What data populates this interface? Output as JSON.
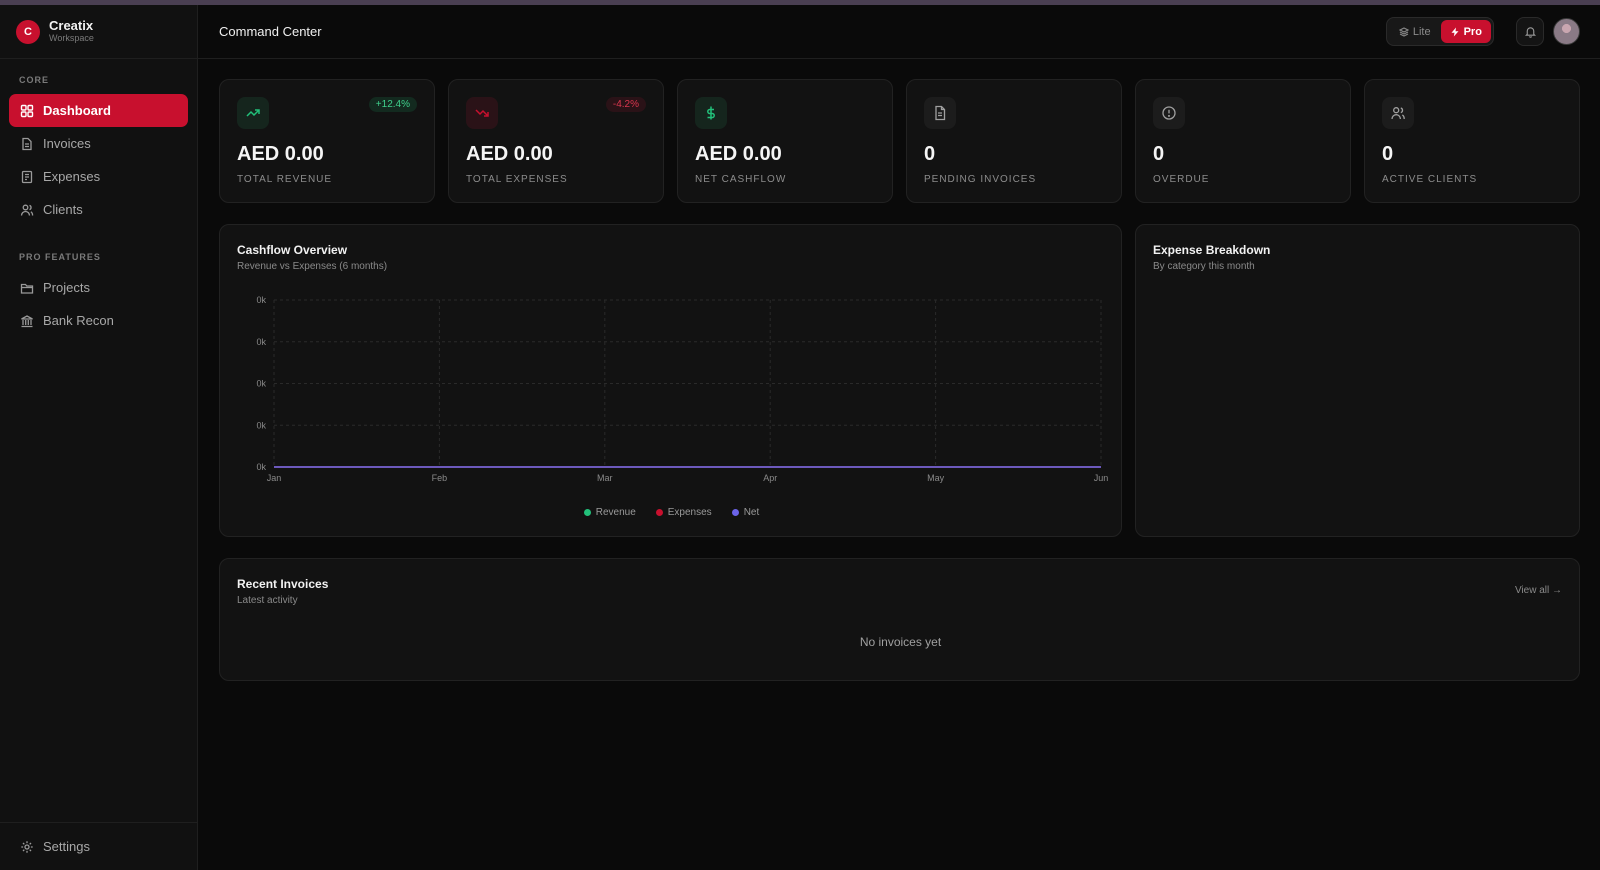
{
  "app": {
    "logo_letter": "C",
    "name": "Creatix",
    "subtitle": "Workspace"
  },
  "sidebar": {
    "sections": [
      {
        "label": "CORE",
        "items": [
          {
            "label": "Dashboard",
            "icon": "grid-icon",
            "active": true
          },
          {
            "label": "Invoices",
            "icon": "document-icon",
            "active": false
          },
          {
            "label": "Expenses",
            "icon": "receipt-icon",
            "active": false
          },
          {
            "label": "Clients",
            "icon": "users-icon",
            "active": false
          }
        ]
      },
      {
        "label": "PRO FEATURES",
        "items": [
          {
            "label": "Projects",
            "icon": "folder-icon",
            "active": false
          },
          {
            "label": "Bank Recon",
            "icon": "bank-icon",
            "active": false
          }
        ]
      }
    ],
    "settings_label": "Settings"
  },
  "header": {
    "title": "Command Center",
    "mode": {
      "lite_label": "Lite",
      "pro_label": "Pro",
      "selected": "Pro"
    }
  },
  "stats": [
    {
      "value": "AED 0.00",
      "label": "TOTAL REVENUE",
      "badge": "+12.4%",
      "icon": "trending-up-icon"
    },
    {
      "value": "AED 0.00",
      "label": "TOTAL EXPENSES",
      "badge": "-4.2%",
      "icon": "trending-down-icon"
    },
    {
      "value": "AED 0.00",
      "label": "NET CASHFLOW",
      "icon": "dollar-icon"
    },
    {
      "value": "0",
      "label": "PENDING INVOICES",
      "icon": "file-icon"
    },
    {
      "value": "0",
      "label": "OVERDUE",
      "icon": "alert-circle-icon"
    },
    {
      "value": "0",
      "label": "ACTIVE CLIENTS",
      "icon": "users-icon"
    }
  ],
  "cashflow": {
    "title": "Cashflow Overview",
    "subtitle": "Revenue vs Expenses (6 months)"
  },
  "expense_breakdown": {
    "title": "Expense Breakdown",
    "subtitle": "By category this month"
  },
  "recent_invoices": {
    "title": "Recent Invoices",
    "subtitle": "Latest activity",
    "view_all": "View all →",
    "empty": "No invoices yet"
  },
  "colors": {
    "accent": "#c8102e",
    "revenue": "#22c07a",
    "expenses": "#c8102e",
    "net": "#6b63e8"
  },
  "chart_data": {
    "type": "line",
    "categories": [
      "Jan",
      "Feb",
      "Mar",
      "Apr",
      "May",
      "Jun"
    ],
    "y_tick_labels": [
      "0k",
      "0k",
      "0k",
      "0k",
      "0k"
    ],
    "series": [
      {
        "name": "Revenue",
        "values": [
          0,
          0,
          0,
          0,
          0,
          0
        ]
      },
      {
        "name": "Expenses",
        "values": [
          0,
          0,
          0,
          0,
          0,
          0
        ]
      },
      {
        "name": "Net",
        "values": [
          0,
          0,
          0,
          0,
          0,
          0
        ]
      }
    ],
    "ylim": [
      0,
      4
    ],
    "grid": true,
    "legend": "bottom-center"
  }
}
